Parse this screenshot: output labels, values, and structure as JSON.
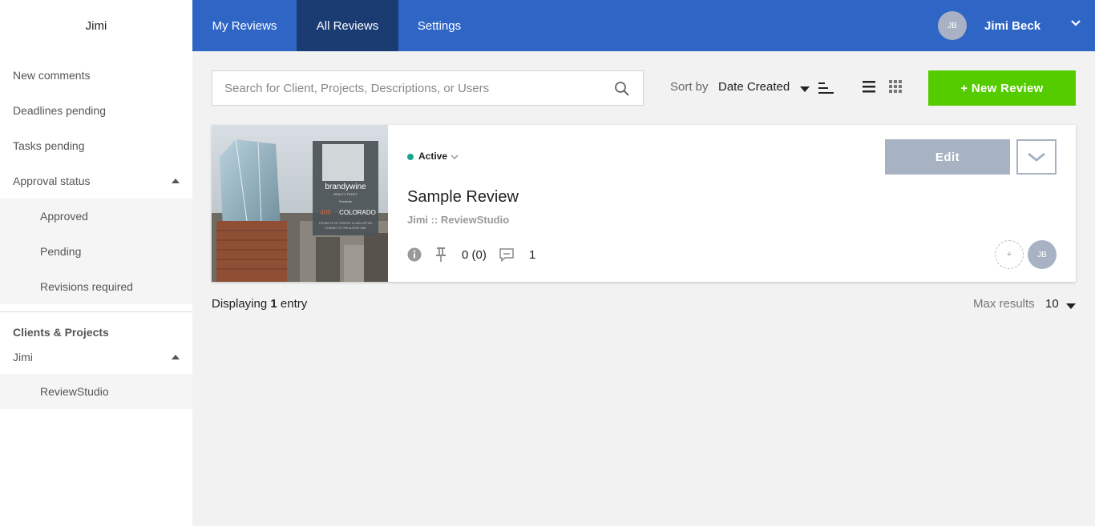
{
  "sidebar": {
    "brand": "Jimi",
    "items": [
      {
        "label": "New comments"
      },
      {
        "label": "Deadlines pending"
      },
      {
        "label": "Tasks pending"
      },
      {
        "label": "Approval status"
      }
    ],
    "approval_sub": [
      {
        "label": "Approved"
      },
      {
        "label": "Pending"
      },
      {
        "label": "Revisions required"
      }
    ],
    "clients_heading": "Clients & Projects",
    "client": "Jimi",
    "projects": [
      {
        "label": "ReviewStudio"
      }
    ]
  },
  "topbar": {
    "tabs": [
      {
        "label": "My Reviews"
      },
      {
        "label": "All Reviews"
      },
      {
        "label": "Settings"
      }
    ],
    "active_tab": "All Reviews",
    "user_initials": "JB",
    "user_name": "Jimi Beck"
  },
  "toolbar": {
    "search_placeholder": "Search for Client, Projects, Descriptions, or Users",
    "search_value": "",
    "sort_label": "Sort by",
    "sort_value": "Date Created",
    "new_review_label": "+ New Review"
  },
  "review": {
    "status": "Active",
    "title": "Sample Review",
    "subtitle": "Jimi :: ReviewStudio",
    "pin_count": "0 (0)",
    "comment_count": "1",
    "edit_label": "Edit",
    "add_member_label": "+",
    "member_initials": "JB",
    "thumbnail": {
      "brand_text": "brandywine",
      "brand_sub": "REALTY TRUST",
      "presents": "Presents",
      "location": "COLORADO",
      "location_prefix": "405",
      "tagline_1": "175,000 SF OF TROPHY CLASS OFFICE",
      "tagline_2": "COMING TO THE AUSTIN CBD"
    }
  },
  "footer": {
    "displaying_prefix": "Displaying",
    "displaying_count": "1",
    "displaying_suffix": "entry",
    "max_label": "Max results",
    "max_value": "10"
  },
  "colors": {
    "topbar": "#2f66c6",
    "active_tab": "#1a3c73",
    "new_review": "#55cc00",
    "edit": "#a7b2c3",
    "status_active": "#1aa58a"
  }
}
